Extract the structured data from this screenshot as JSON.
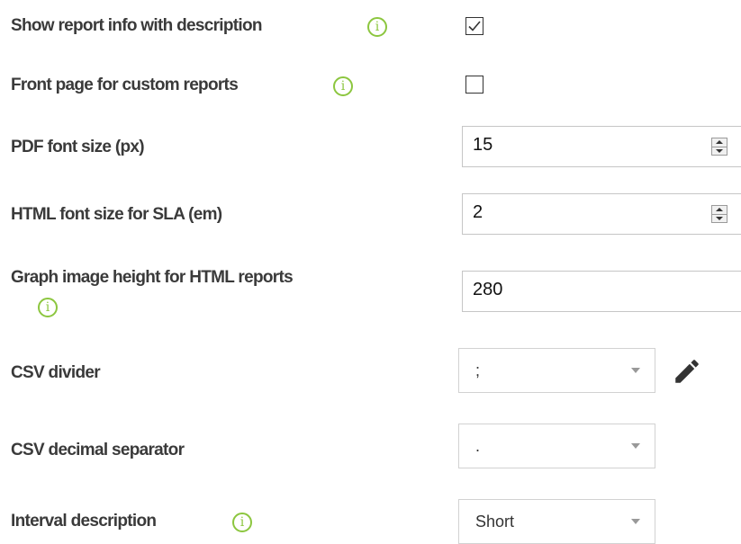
{
  "settings": {
    "show_report_info": {
      "label": "Show report info with description",
      "checked": true
    },
    "front_page": {
      "label": "Front page for custom reports",
      "checked": false
    },
    "pdf_font_size": {
      "label": "PDF font size (px)",
      "value": "15"
    },
    "html_font_size": {
      "label": "HTML font size for SLA (em)",
      "value": "2"
    },
    "graph_height": {
      "label": "Graph image height for HTML reports",
      "value": "280"
    },
    "csv_divider": {
      "label": "CSV divider",
      "value": ";"
    },
    "csv_decimal": {
      "label": "CSV decimal separator",
      "value": "."
    },
    "interval_description": {
      "label": "Interval description",
      "value": "Short"
    }
  },
  "icons": {
    "info": "info-icon",
    "edit": "pencil-icon",
    "info_color": "#8cc63f"
  }
}
